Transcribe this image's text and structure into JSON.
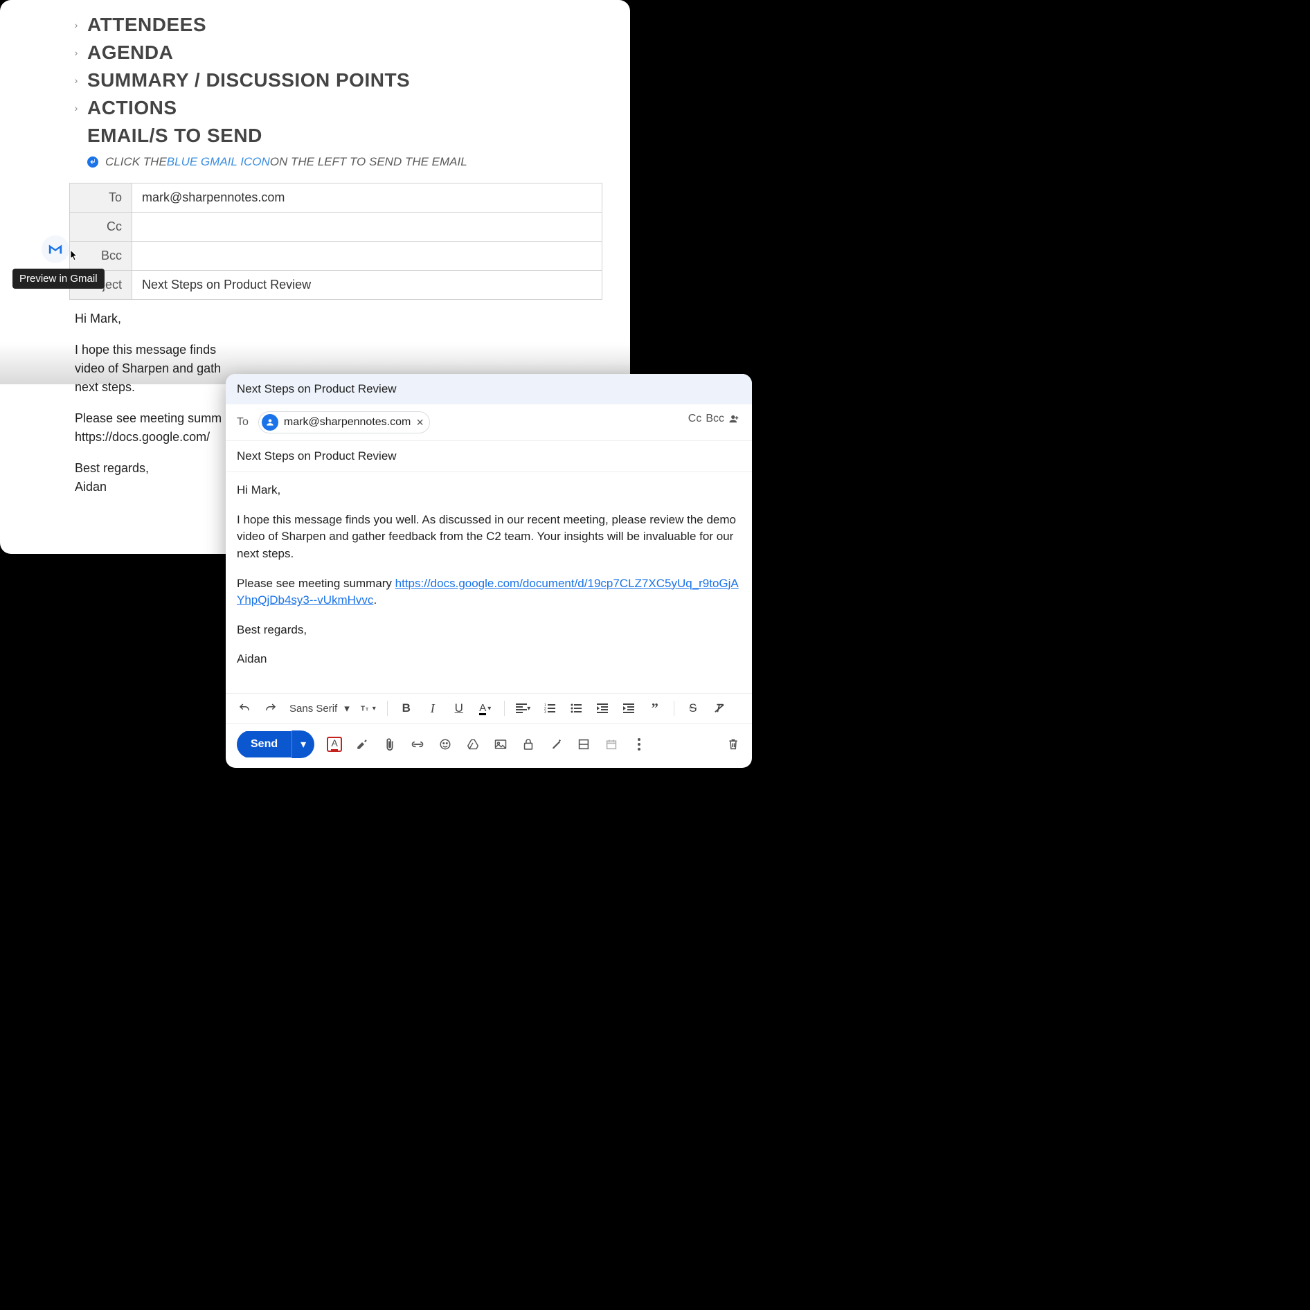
{
  "doc": {
    "sections": {
      "attendees": "ATTENDEES",
      "agenda": "AGENDA",
      "summary": "SUMMARY / DISCUSSION POINTS",
      "actions": "ACTIONS",
      "emails": "EMAIL/S TO SEND"
    },
    "hint": {
      "prefix": "CLICK THE ",
      "blue": "BLUE GMAIL ICON",
      "suffix": " ON THE LEFT TO SEND THE EMAIL"
    },
    "table": {
      "to_label": "To",
      "to_value": "mark@sharpennotes.com",
      "cc_label": "Cc",
      "cc_value": "",
      "bcc_label": "Bcc",
      "bcc_value": "",
      "subject_label": "Subject",
      "subject_value": "Next Steps on Product Review"
    },
    "body": {
      "greeting": "Hi Mark,",
      "p1": "I hope this message finds",
      "p1b": "video of Sharpen and gath",
      "p1c": "next steps.",
      "p2a": "Please see meeting summ",
      "p2b": "https://docs.google.com/",
      "signoff": "Best regards,",
      "name": "Aidan"
    },
    "tooltip": "Preview in Gmail"
  },
  "compose": {
    "title": "Next Steps on Product Review",
    "to_label": "To",
    "to_chip": "mark@sharpennotes.com",
    "cc": "Cc",
    "bcc": "Bcc",
    "subject": "Next Steps on Product Review",
    "greeting": "Hi Mark,",
    "p1": "I hope this message finds you well. As discussed in our recent meeting, please review the demo video of Sharpen and gather feedback from the C2 team. Your insights will be invaluable for our next steps.",
    "p2_prefix": "Please see meeting summary ",
    "p2_link": "https://docs.google.com/document/d/19cp7CLZ7XC5yUq_r9toGjAYhpQjDb4sy3--vUkmHvvc",
    "p2_suffix": ".",
    "signoff": "Best regards,",
    "name": "Aidan",
    "font": "Sans Serif",
    "send": "Send"
  }
}
